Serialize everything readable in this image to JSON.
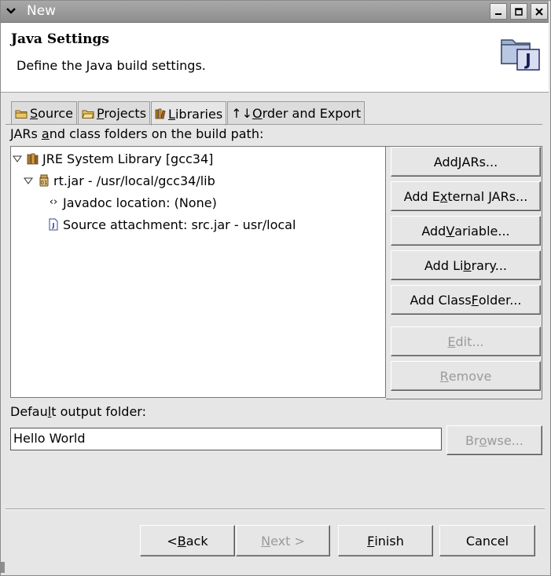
{
  "window": {
    "title": "New",
    "minimize": "▁",
    "maximize": "□",
    "close": "✕"
  },
  "header": {
    "title": "Java Settings",
    "description": "Define the Java build settings.",
    "icon_letter": "J"
  },
  "tabs": [
    {
      "pre": "",
      "u": "S",
      "post": "ource",
      "icon": "folder-icon"
    },
    {
      "pre": "",
      "u": "P",
      "post": "rojects",
      "icon": "projects-icon"
    },
    {
      "pre": "",
      "u": "L",
      "post": "ibraries",
      "icon": "library-icon",
      "active": true
    },
    {
      "pre": "↑↓",
      "u": "O",
      "post": "rder and Export",
      "icon": "order-icon"
    }
  ],
  "build_path_label": {
    "pre": "JARs ",
    "u": "a",
    "post": "nd class folders on the build path:"
  },
  "tree": [
    {
      "label": "JRE System Library [gcc34]",
      "icon": "library-icon",
      "expanded": true
    },
    {
      "label": "rt.jar - /usr/local/gcc34/lib",
      "icon": "jar-icon",
      "expanded": true
    },
    {
      "label": "Javadoc location: (None)",
      "icon": "javadoc-icon"
    },
    {
      "label": "Source attachment: src.jar - usr/local",
      "icon": "source-icon"
    }
  ],
  "buttons": {
    "add_jars": {
      "pre": "Add ",
      "u": "J",
      "post": "ARs..."
    },
    "add_external_jars": {
      "pre": "Add E",
      "u": "x",
      "post": "ternal JARs..."
    },
    "add_variable": {
      "pre": "Add ",
      "u": "V",
      "post": "ariable..."
    },
    "add_library": {
      "pre": "Add Li",
      "u": "b",
      "post": "rary..."
    },
    "add_class_folder": {
      "pre": "Add Class ",
      "u": "F",
      "post": "older..."
    },
    "edit": {
      "pre": "",
      "u": "E",
      "post": "dit..."
    },
    "remove": {
      "pre": "",
      "u": "R",
      "post": "emove"
    }
  },
  "output": {
    "label_pre": "Defau",
    "label_u": "l",
    "label_post": "t output folder:",
    "value": "Hello World",
    "browse": {
      "pre": "Br",
      "u": "o",
      "post": "wse..."
    }
  },
  "footer": {
    "back": {
      "pre": "< ",
      "u": "B",
      "post": "ack"
    },
    "next": {
      "pre": "",
      "u": "N",
      "post": "ext >"
    },
    "finish": {
      "pre": "",
      "u": "F",
      "post": "inish"
    },
    "cancel": "Cancel"
  }
}
